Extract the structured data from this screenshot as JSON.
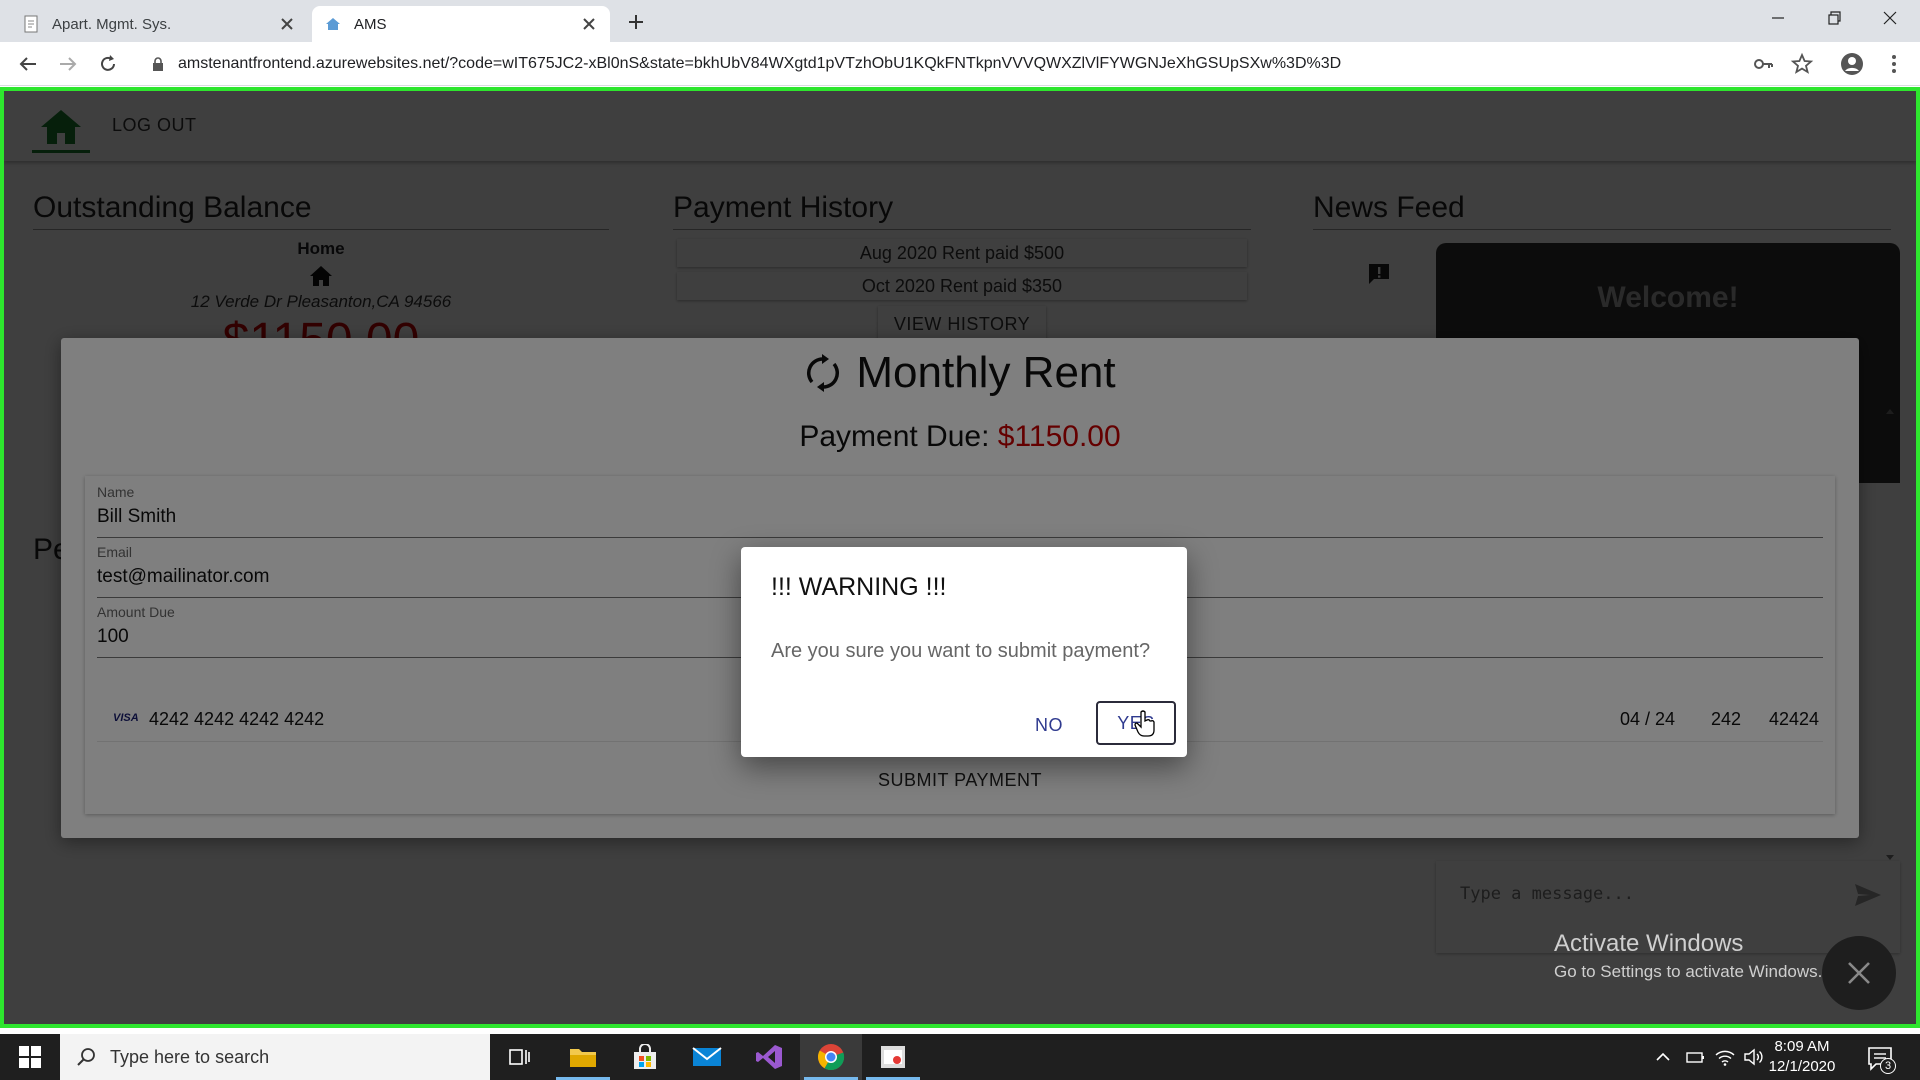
{
  "browser": {
    "tabs": [
      {
        "title": "Apart. Mgmt. Sys.",
        "active": false
      },
      {
        "title": "AMS",
        "active": true
      }
    ],
    "url": "amstenantfrontend.azurewebsites.net/?code=wIT675JC2-xBl0nS&state=bkhUbV84WXgtd1pVTzhObU1KQkFNTkpnVVVQWXZlVlFYWGNJeXhGSUpSXw%3D%3D"
  },
  "app": {
    "logout_label": "LOG OUT",
    "accent_color": "#1a7f2e",
    "outstanding": {
      "title": "Outstanding Balance",
      "property_name": "Home",
      "address": "12 Verde Dr Pleasanton,CA 94566",
      "amount": "$1150.00"
    },
    "payment_history": {
      "title": "Payment History",
      "items": [
        "Aug 2020 Rent paid $500",
        "Oct 2020 Rent paid $350"
      ],
      "view_label": "VIEW HISTORY"
    },
    "news_feed": {
      "title": "News Feed",
      "welcome": "Welcome!",
      "chat_placeholder": "Type a message..."
    },
    "partial_heading": "Pe"
  },
  "rent_modal": {
    "title": "Monthly Rent",
    "due_label": "Payment Due:",
    "due_amount": "$1150.00",
    "fields": [
      {
        "label": "Name",
        "value": "Bill Smith"
      },
      {
        "label": "Email",
        "value": "test@mailinator.com"
      },
      {
        "label": "Amount Due",
        "value": "100"
      }
    ],
    "card": {
      "brand": "VISA",
      "number": "4242 4242 4242 4242",
      "expiry": "04 / 24",
      "cvc": "242",
      "zip": "42424"
    },
    "submit_label": "SUBMIT PAYMENT"
  },
  "warning": {
    "title": "!!! WARNING !!!",
    "message": "Are you sure you want to submit payment?",
    "no_label": "NO",
    "yes_label": "YES"
  },
  "watermark": {
    "line1": "Activate Windows",
    "line2": "Go to Settings to activate Windows."
  },
  "taskbar": {
    "search_placeholder": "Type here to search",
    "time": "8:09 AM",
    "date": "12/1/2020",
    "notifications": "3"
  }
}
